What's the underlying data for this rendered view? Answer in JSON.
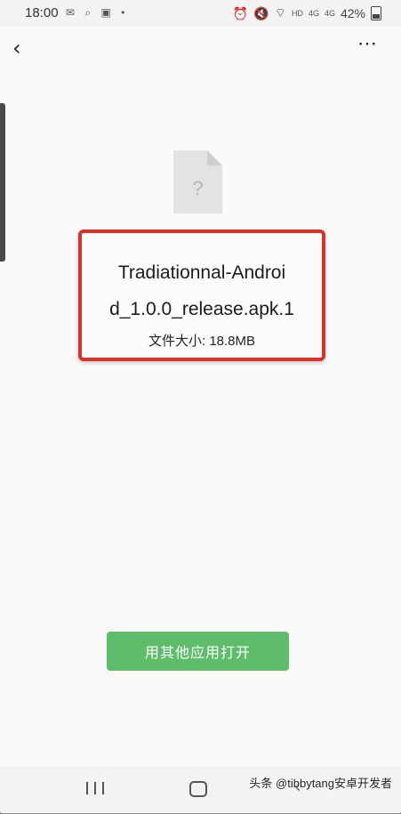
{
  "status_bar": {
    "time": "18:00",
    "left_icons": [
      "wechat-icon",
      "search-icon",
      "image-icon",
      "dot-icon"
    ],
    "right_icons": [
      "alarm-icon",
      "mute-icon",
      "wifi-icon",
      "hd-icon",
      "signal-4g-icon",
      "signal-4g-icon"
    ],
    "hd_label": "HD",
    "net_label_1": "4G",
    "net_label_2": "4G",
    "battery": "42%"
  },
  "header": {
    "back_icon": "back-arrow-icon",
    "more_icon": "more-icon"
  },
  "file": {
    "icon": "unknown-file-icon",
    "icon_glyph": "?",
    "name_line1": "Tradiationnal-Androi",
    "name_line2": "d_1.0.0_release.apk.1",
    "size_label": "文件大小: 18.8MB"
  },
  "actions": {
    "open_with_other_app": "用其他应用打开"
  },
  "nav_bar": {
    "icons": [
      "recent-apps-icon",
      "home-icon",
      "back-icon"
    ]
  },
  "watermark": {
    "text": "头条 @tibbytang安卓开发者"
  },
  "colors": {
    "highlight_border": "#d8322c",
    "button_green": "#5ebd6a"
  }
}
